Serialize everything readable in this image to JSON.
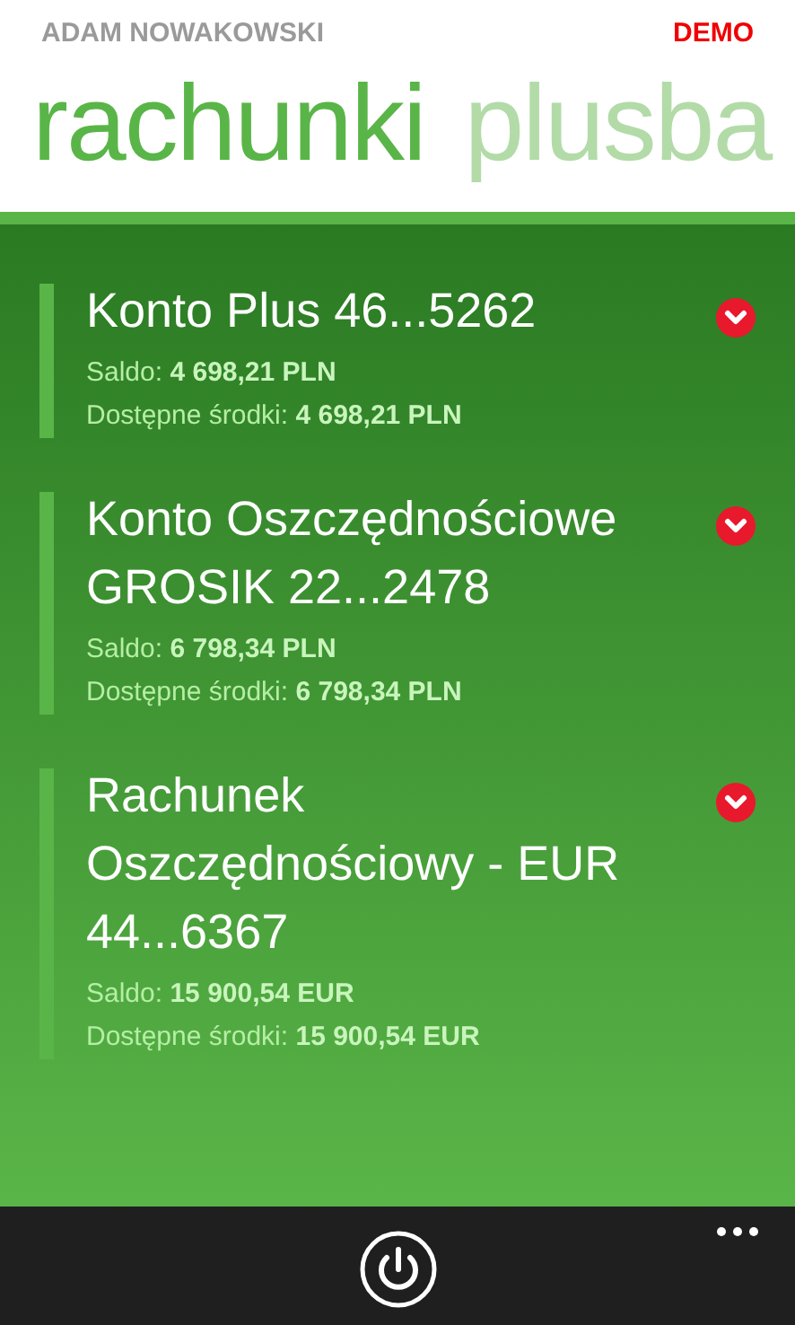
{
  "user_name": "ADAM NOWAKOWSKI",
  "badge": "DEMO",
  "pivot": [
    {
      "label": "rachunki",
      "selected": true
    },
    {
      "label": "plusba",
      "selected": false
    }
  ],
  "accounts": [
    {
      "title": "Konto Plus 46...5262",
      "balance_label": "Saldo:",
      "balance": "4 698,21 PLN",
      "available_label": "Dostępne środki:",
      "available": "4 698,21 PLN"
    },
    {
      "title": "Konto Oszczędnościowe GROSIK 22...2478",
      "balance_label": "Saldo:",
      "balance": "6 798,34 PLN",
      "available_label": "Dostępne środki:",
      "available": "6 798,34 PLN"
    },
    {
      "title": "Rachunek Oszczędnościowy - EUR 44...6367",
      "balance_label": "Saldo:",
      "balance": "15 900,54 EUR",
      "available_label": "Dostępne środki:",
      "available": "15 900,54 EUR"
    }
  ]
}
